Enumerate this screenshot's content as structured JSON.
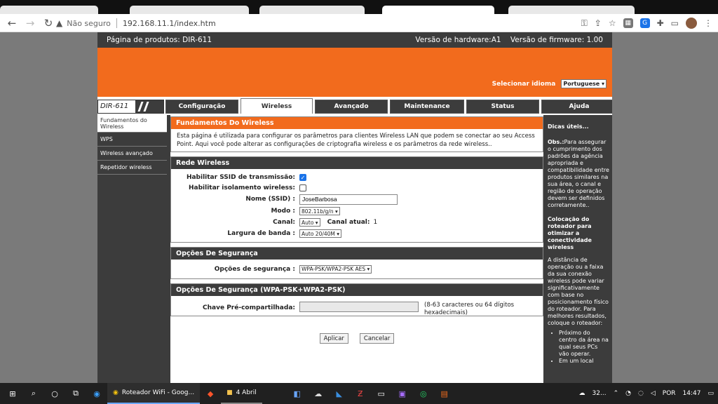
{
  "browser": {
    "security_label": "Não seguro",
    "url": "192.168.11.1/index.htm"
  },
  "router": {
    "product": "Página de produtos: DIR-611",
    "hardware": "Versão de hardware:A1",
    "firmware": "Versão de firmware: 1.00",
    "language_label": "Selecionar idioma",
    "language_value": "Portuguese",
    "model": "DIR-611",
    "tabs": [
      "Configuração",
      "Wireless",
      "Avançado",
      "Maintenance",
      "Status",
      "Ajuda"
    ],
    "active_tab": "Wireless",
    "sidebar": [
      "Fundamentos do Wireless",
      "WPS",
      "Wireless avançado",
      "Repetidor wireless"
    ],
    "section_title": "Fundamentos Do Wireless",
    "intro": "Esta página é utilizada para configurar os parâmetros para clientes Wireless LAN que podem se conectar ao seu Access Point. Aqui você pode alterar as configurações de criptografia wireless e os parâmetros da rede wireless..",
    "rede_title": "Rede Wireless",
    "ssid_broadcast_label": "Habilitar SSID de transmissão:",
    "isolation_label": "Habilitar isolamento wireless:",
    "name_label": "Nome (SSID) :",
    "name_value": "JoseBarbosa",
    "mode_label": "Modo :",
    "mode_value": "802.11b/g/n",
    "channel_label": "Canal:",
    "channel_value": "Auto",
    "channel_current_label": "Canal atual:",
    "channel_current_value": "1",
    "bandwidth_label": "Largura de banda :",
    "bandwidth_value": "Auto 20/40M",
    "security_title": "Opções De Segurança",
    "security_label": "Opções de segurança :",
    "security_value": "WPA-PSK/WPA2-PSK AES",
    "wpa_title": "Opções De Segurança (WPA-PSK+WPA2-PSK)",
    "psk_label": "Chave Pré-compartilhada:",
    "psk_hint": "(8-63 caracteres ou 64 dígitos hexadecimais)",
    "apply": "Aplicar",
    "cancel": "Cancelar"
  },
  "tips": {
    "title": "Dicas úteis...",
    "obs_label": "Obs.:",
    "obs_text": "Para assegurar o cumprimento dos padrões da agência apropriada e compatibilidade entre produtos similares na sua área, o canal e região de operação devem ser definidos corretamente..",
    "place_title": "Colocação do roteador para otimizar a conectividade wireless",
    "place_text": "A distância de operação ou a faixa da sua conexão wireless pode variar significativamente com base no posicionamento físico do roteador. Para melhores resultados, coloque o roteador:",
    "bullets": [
      "Próximo do centro da área na qual seus PCs vão operar.",
      "Em um local"
    ]
  },
  "taskbar": {
    "chrome_task": "Roteador WiFi - Goog...",
    "folder_task": "4 Abril",
    "weather": "32...",
    "language": "POR",
    "time": "14:47"
  }
}
